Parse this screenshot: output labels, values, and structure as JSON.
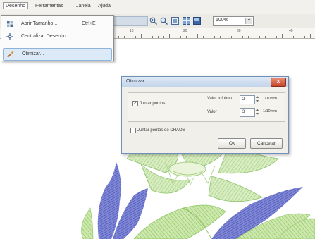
{
  "menubar": {
    "items": [
      "Desenho",
      "Ferramentas",
      "Janela",
      "Ajuda"
    ]
  },
  "toolbar": {
    "zoom_value": "100%",
    "icons": [
      "zoom-in-icon",
      "zoom-out-icon",
      "fit-page-icon",
      "grid-icon",
      "view-icon"
    ]
  },
  "ruler": {
    "labels": [
      "10",
      "20",
      "30",
      "40"
    ]
  },
  "dropdown": {
    "items": [
      {
        "label": "Abrir Tamanho...",
        "shortcut": "Ctrl+E",
        "icon": "resize-icon"
      },
      {
        "label": "Centralizar Desenho",
        "shortcut": "",
        "icon": "center-icon"
      },
      {
        "label": "Otimizar...",
        "shortcut": "",
        "icon": "optimize-icon"
      }
    ]
  },
  "dialog": {
    "title": "Otimizar",
    "close_label": "X",
    "group_checkbox_label": "Juntar pontos",
    "value_label_1": "Valor mínimo",
    "value_1": "2",
    "unit_1": "1/10mm",
    "value_label_2": "Valor",
    "value_2": "3",
    "unit_2": "1/10mm",
    "bottom_checkbox_label": "Juntar pontos do CHAOS",
    "ok_label": "Ok",
    "cancel_label": "Cancelar"
  },
  "colors": {
    "highlight": "#dce9f7",
    "dialog_border": "#6f8fb8",
    "leaf_green": "#b9dc8f",
    "petal_blue": "#6a72c9",
    "petal_green": "#c9e4ab"
  }
}
